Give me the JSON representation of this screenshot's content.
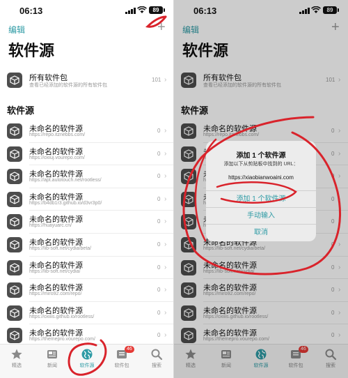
{
  "status": {
    "time": "06:13",
    "battery": "89"
  },
  "nav": {
    "edit_label": "编辑",
    "add_label": "+"
  },
  "title": "软件源",
  "all_packages": {
    "title": "所有软件包",
    "subtitle": "查看已经添加的软件源的所有软件包",
    "count": "101",
    "chevron": "›"
  },
  "section_header": "软件源",
  "sources": [
    {
      "name": "未命名的软件源",
      "url": "https://repo.itznebbs.com/",
      "count": "0"
    },
    {
      "name": "未命名的软件源",
      "url": "https://oxiuj.vourepo.com/",
      "count": "0"
    },
    {
      "name": "未命名的软件源",
      "url": "https://apt.autotouch.net/rootless/",
      "count": "0"
    },
    {
      "name": "未命名的软件源",
      "url": "https://b4db1r3.github.io/d3vr3p0/",
      "count": "0"
    },
    {
      "name": "未命名的软件源",
      "url": "https://huayuarc.cn/",
      "count": "0"
    },
    {
      "name": "未命名的软件源",
      "url": "https://lib-soft.net/cydia/beta/",
      "count": "0"
    },
    {
      "name": "未命名的软件源",
      "url": "https://lib-soft.net/cydia/",
      "count": "0"
    },
    {
      "name": "未命名的软件源",
      "url": "https://miro92.com/repo/",
      "count": "0"
    },
    {
      "name": "未命名的软件源",
      "url": "https://oxiiis.github.io/rootless/",
      "count": "0"
    },
    {
      "name": "未命名的软件源",
      "url": "https://themepro.vourepo.com/",
      "count": "0"
    }
  ],
  "tabs": [
    {
      "label": "精选",
      "icon": "star-icon"
    },
    {
      "label": "新闻",
      "icon": "newspaper-icon"
    },
    {
      "label": "软件源",
      "icon": "globe-icon",
      "active": true
    },
    {
      "label": "软件包",
      "icon": "package-icon",
      "badge": "46"
    },
    {
      "label": "搜索",
      "icon": "search-icon"
    }
  ],
  "dialog": {
    "title": "添加 1 个软件源",
    "message": "添加以下从剪贴板中找到的 URL：",
    "url": "https://xiaobianwoaini.com",
    "confirm_label": "添加 1 个软件源",
    "manual_label": "手动输入",
    "cancel_label": "取消"
  },
  "colors": {
    "accent": "#2f9ba5",
    "badge": "#e53935",
    "annotation": "#d9232b",
    "icon_bg": "#4d4d4d"
  }
}
